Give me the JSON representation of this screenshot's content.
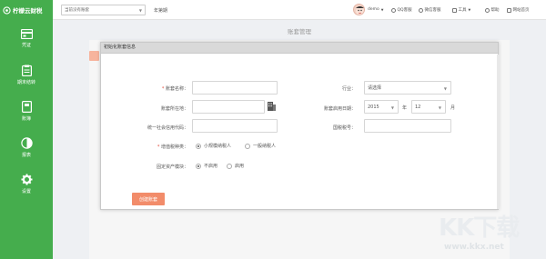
{
  "brand": {
    "name": "柠檬云财税"
  },
  "sidebar": {
    "items": [
      {
        "label": "凭证",
        "icon": "voucher-icon"
      },
      {
        "label": "期末结转",
        "icon": "clipboard-icon"
      },
      {
        "label": "账簿",
        "icon": "ledger-icon"
      },
      {
        "label": "报表",
        "icon": "pie-chart-icon"
      },
      {
        "label": "设置",
        "icon": "gear-icon"
      }
    ]
  },
  "topbar": {
    "book_select": "当前没有账套",
    "period": "年第期",
    "user": "demo",
    "links": [
      {
        "label": "QQ客服"
      },
      {
        "label": "微信客服"
      },
      {
        "label": "工具"
      },
      {
        "label": "帮助"
      },
      {
        "label": "网站首页"
      }
    ]
  },
  "page": {
    "title": "账套管理"
  },
  "dialog": {
    "title": "初始化账套信息",
    "fields": {
      "name_label": "账套名称：",
      "industry_label": "行业：",
      "industry_value": "请选择",
      "location_label": "账套所在地：",
      "start_date_label": "账套启用日期：",
      "start_year": "2015",
      "year_unit": "年",
      "start_month": "12",
      "month_unit": "月",
      "credit_code_label": "统一社会信用代码：",
      "tax_no_label": "国税税号：",
      "vat_type_label": "增值税种类：",
      "vat_options": [
        "小规模纳税人",
        "一般纳税人"
      ],
      "vat_selected": 0,
      "fixed_assets_label": "固定资产模块：",
      "fa_options": [
        "不启用",
        "启用"
      ],
      "fa_selected": 0
    },
    "create_button": "创建账套"
  },
  "watermark": {
    "logo": "KK下载",
    "url": "www.kkx.net"
  },
  "colors": {
    "sidebar": "#45ad4d",
    "accent_button": "#f28c6a",
    "required": "#e24c3c"
  }
}
